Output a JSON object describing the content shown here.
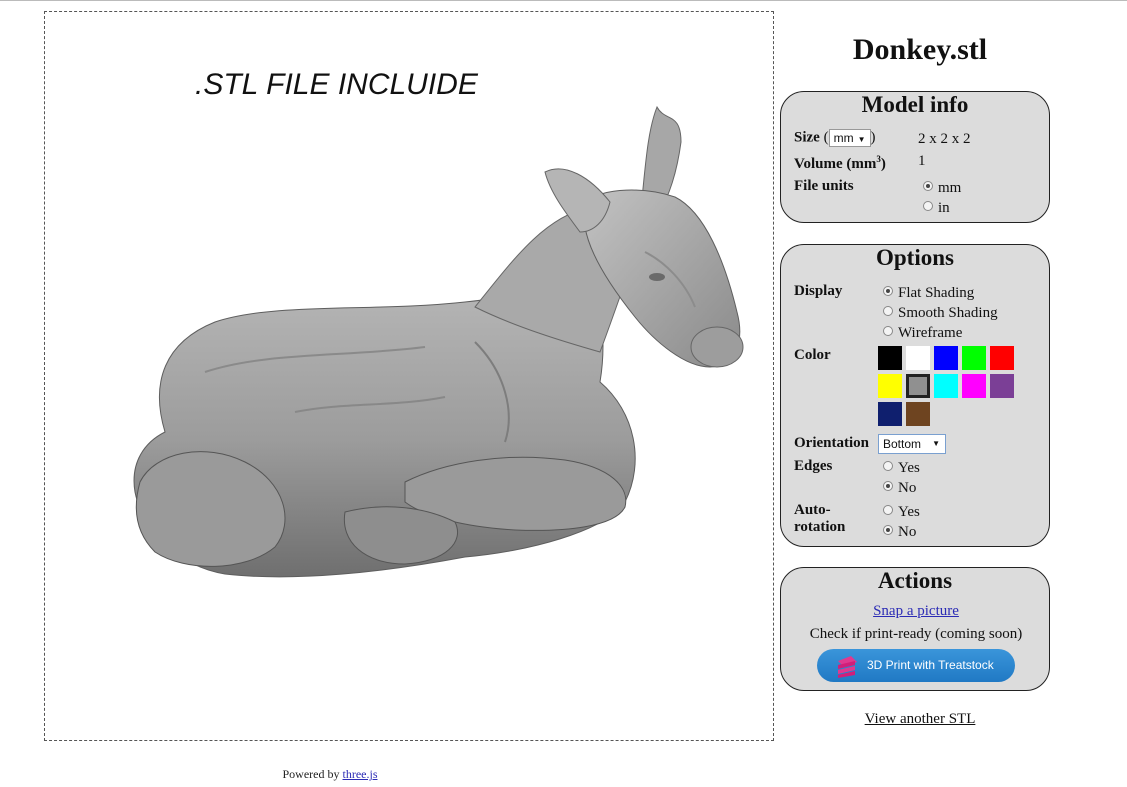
{
  "viewer": {
    "caption": ".STL FILE INCLUIDE"
  },
  "file_title": "Donkey.stl",
  "model_info": {
    "heading": "Model info",
    "size_label": "Size",
    "size_paren_open": "(",
    "size_paren_close": ")",
    "size_unit_selected": "mm",
    "size_value": "2 x 2 x 2",
    "volume_label": "Volume (mm",
    "volume_sup": "3",
    "volume_close": ")",
    "volume_value": "1",
    "file_units_label": "File units",
    "file_units_options": [
      "mm",
      "in"
    ],
    "file_units_selected": "mm"
  },
  "options": {
    "heading": "Options",
    "display_label": "Display",
    "display_options": [
      "Flat Shading",
      "Smooth Shading",
      "Wireframe"
    ],
    "display_selected": "Flat Shading",
    "color_label": "Color",
    "colors": [
      "#000000",
      "#ffffff",
      "#0000ff",
      "#00ff00",
      "#ff0000",
      "#ffff00",
      "#909090",
      "#00ffff",
      "#ff00ff",
      "#7b3f96",
      "#0f1f6e",
      "#6e4420"
    ],
    "color_selected": "#909090",
    "orientation_label": "Orientation",
    "orientation_selected": "Bottom",
    "edges_label": "Edges",
    "edges_options": [
      "Yes",
      "No"
    ],
    "edges_selected": "No",
    "autorotation_label_1": "Auto-",
    "autorotation_label_2": "rotation",
    "autorotation_options": [
      "Yes",
      "No"
    ],
    "autorotation_selected": "No"
  },
  "actions": {
    "heading": "Actions",
    "snap_link": "Snap a picture",
    "check_text": "Check if print-ready (coming soon)",
    "print_button": "3D Print with Treatstock"
  },
  "view_another": "View another STL",
  "footer": {
    "prefix": "Powered by ",
    "link": "three.js"
  }
}
